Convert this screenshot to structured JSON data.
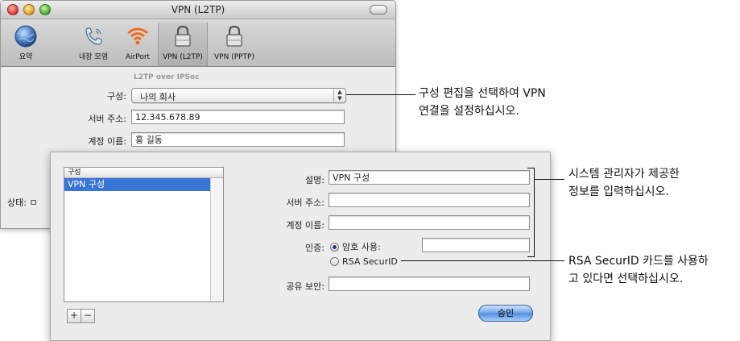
{
  "window": {
    "title": "VPN (L2TP)",
    "toolbar": [
      {
        "label": "요약",
        "icon": "globe-icon",
        "selected": false
      },
      {
        "label": "내장 모뎀",
        "icon": "phone-icon",
        "selected": false
      },
      {
        "label": "AirPort",
        "icon": "wifi-icon",
        "selected": false
      },
      {
        "label": "VPN (L2TP)",
        "icon": "padlock-icon",
        "selected": true
      },
      {
        "label": "VPN (PPTP)",
        "icon": "padlock-icon",
        "selected": false
      }
    ],
    "section_label": "L2TP over IPSec",
    "config_label": "구성:",
    "config_value": "나의 회사",
    "server_label": "서버 주소:",
    "server_value": "12.345.678.89",
    "account_label": "계정 이름:",
    "account_value": "홍 길동",
    "status_label": "상태: ㅁ"
  },
  "sheet": {
    "list_header": "구성",
    "list_items": [
      "VPN 구성"
    ],
    "desc_label": "설명:",
    "desc_value": "VPN 구성",
    "server_label": "서버 주소:",
    "server_value": "",
    "account_label": "계정 이름:",
    "account_value": "",
    "auth_label": "인증:",
    "auth_password": "암호 사용:",
    "auth_password_value": "",
    "auth_rsa": "RSA SecurID",
    "shared_secret_label": "공유 보안:",
    "shared_secret_value": "",
    "add_button": "+",
    "remove_button": "−",
    "ok_button": "승인"
  },
  "callouts": {
    "config": [
      "구성 편집을 선택하여 VPN",
      "연결을 설정하십시오."
    ],
    "admin": [
      "시스템 관리자가 제공한",
      "정보를 입력하십시오."
    ],
    "rsa": [
      "RSA SecurID 카드를 사용하",
      "고 있다면 선택하십시오."
    ]
  }
}
